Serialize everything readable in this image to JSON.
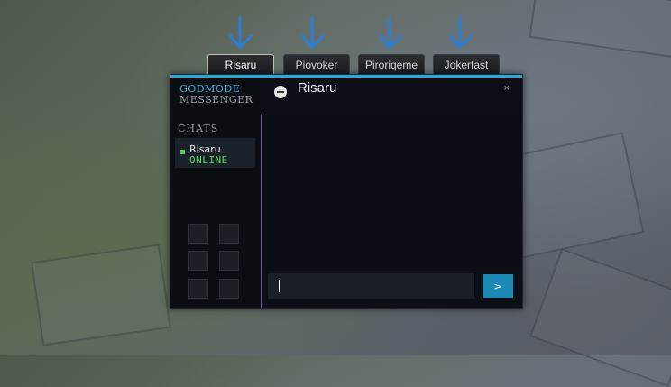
{
  "tabs": [
    {
      "label": "Risaru",
      "active": true
    },
    {
      "label": "Piovoker",
      "active": false
    },
    {
      "label": "Piroriqeme",
      "active": false
    },
    {
      "label": "Jokerfast",
      "active": false
    }
  ],
  "app": {
    "logo_line1": "GODMODE",
    "logo_line2": "MESSENGER"
  },
  "sidebar": {
    "section_label": "CHATS",
    "chats": [
      {
        "name": "Risaru",
        "status": "ONLINE"
      }
    ]
  },
  "conversation": {
    "title": "Risaru",
    "close_label": "×"
  },
  "composer": {
    "value": "",
    "send_label": ">"
  },
  "colors": {
    "accent": "#2ca8d4",
    "online": "#52e05f",
    "divider": "#7a4fb0",
    "arrow": "#2a7fd4"
  },
  "icons": [
    "arrow-down-icon",
    "chat-bubble-icon",
    "close-icon",
    "hero-portrait-icon"
  ]
}
